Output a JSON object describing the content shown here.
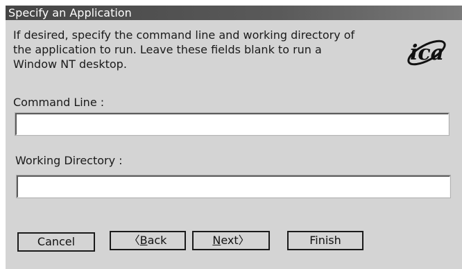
{
  "dialog": {
    "title": "Specify an Application",
    "description_lines": [
      "If desired, specify the command line and working directory of",
      "the application to run. Leave these fields blank to run a",
      "Window NT desktop."
    ],
    "logo_text": "ica"
  },
  "form": {
    "command_line_label": "Command Line :",
    "command_line_value": "",
    "working_directory_label": "Working Directory :",
    "working_directory_value": ""
  },
  "buttons": {
    "cancel": "Cancel",
    "back_arrow": "〈",
    "back_mnemonic": "B",
    "back_rest": "ack",
    "next_mnemonic": "N",
    "next_rest": "ext",
    "next_arrow": "〉",
    "finish": "Finish"
  }
}
